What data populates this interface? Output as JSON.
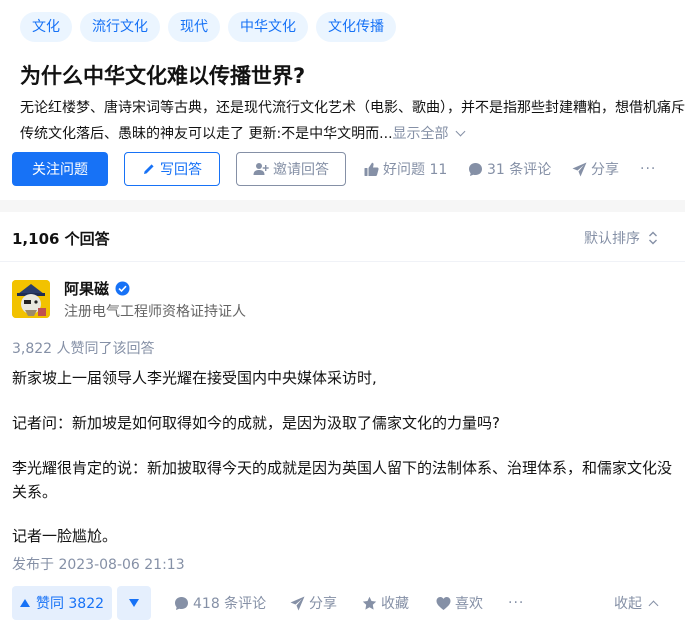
{
  "question": {
    "tags": [
      "文化",
      "流行文化",
      "现代",
      "中华文化",
      "文化传播"
    ],
    "title": "为什么中华文化难以传播世界?",
    "excerpt": "无论红楼梦、唐诗宋词等古典，还是现代流行文化艺术（电影、歌曲），并不是指那些封建糟粕，想借机痛斥传统文化落后、愚昧的神友可以走了 更新:不是中华文明而...",
    "show_all": "显示全部",
    "follow_label": "关注问题",
    "write_label": "写回答",
    "invite_label": "邀请回答",
    "good_question": "好问题 11",
    "comments": "31 条评论",
    "share": "分享",
    "more": "···"
  },
  "answers": {
    "count": "1,106 个回答",
    "sort": "默认排序",
    "answer": {
      "author": "阿果磁",
      "author_title": "注册电气工程师资格证持证人",
      "upvoted_text": "3,822 人赞同了该回答",
      "paragraphs": [
        "新家坡上一届领导人李光耀在接受国内中央媒体采访时,",
        "记者问：新加坡是如何取得如今的成就，是因为汲取了儒家文化的力量吗?",
        "李光耀很肯定的说：新加披取得今天的成就是因为英国人留下的法制体系、治理体系，和儒家文化没关系。",
        "记者一脸尴尬。"
      ],
      "published": "发布于 2023-08-06 21:13",
      "upvote_label": "赞同 3822",
      "comments": "418 条评论",
      "share": "分享",
      "collect": "收藏",
      "like": "喜欢",
      "more": "···",
      "collapse": "收起"
    }
  },
  "colors": {
    "accent": "#1772f6",
    "muted": "#8590a6",
    "tag_bg": "#ebf5ff"
  }
}
